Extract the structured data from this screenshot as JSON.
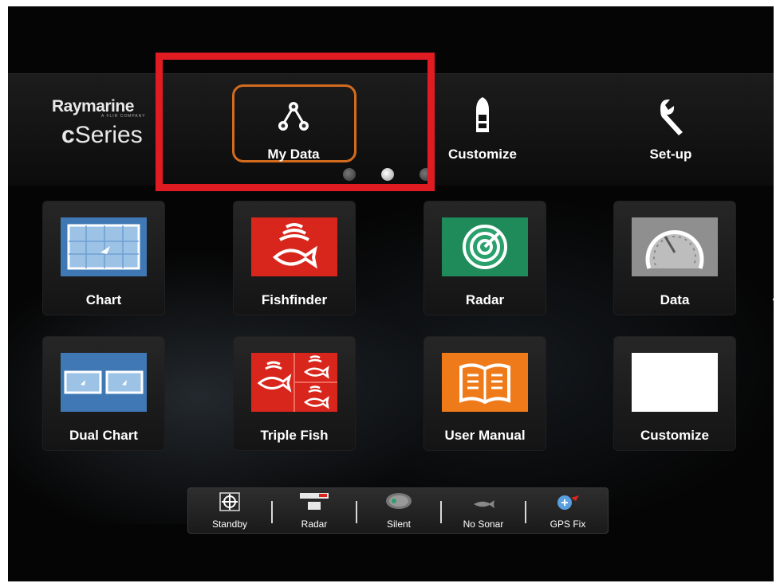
{
  "brand": {
    "name": "Raymarine",
    "tagline": "A FLIR COMPANY",
    "series_prefix": "c",
    "series": "Series"
  },
  "topnav": [
    {
      "label": "My Data",
      "icon": "network-icon",
      "selected": true
    },
    {
      "label": "Customize",
      "icon": "boat-icon"
    },
    {
      "label": "Set-up",
      "icon": "wrench-icon"
    }
  ],
  "page_indicator": {
    "pages": 3,
    "current": 2
  },
  "apps": [
    {
      "label": "Chart",
      "icon": "chart-icon"
    },
    {
      "label": "Fishfinder",
      "icon": "fishfinder-icon"
    },
    {
      "label": "Radar",
      "icon": "radar-icon"
    },
    {
      "label": "Data",
      "icon": "gauge-icon"
    },
    {
      "label": "Dual Chart",
      "icon": "dual-chart-icon"
    },
    {
      "label": "Triple Fish",
      "icon": "triple-fish-icon"
    },
    {
      "label": "User Manual",
      "icon": "book-icon"
    },
    {
      "label": "Customize",
      "icon": "blank-app-icon"
    }
  ],
  "status": [
    {
      "label": "Standby",
      "icon": "autopilot-icon"
    },
    {
      "label": "Radar",
      "icon": "radar-scanner-icon"
    },
    {
      "label": "Silent",
      "icon": "ais-icon"
    },
    {
      "label": "No Sonar",
      "icon": "sonar-fish-icon"
    },
    {
      "label": "GPS Fix",
      "icon": "gps-icon"
    }
  ],
  "colors": {
    "highlight": "#e11b22",
    "selected_frame": "#d26b1e",
    "fish_red": "#d8261c",
    "radar_green": "#1f8a5a",
    "manual_orange": "#ee7a1a",
    "chart_blue": "#3f78b4"
  }
}
